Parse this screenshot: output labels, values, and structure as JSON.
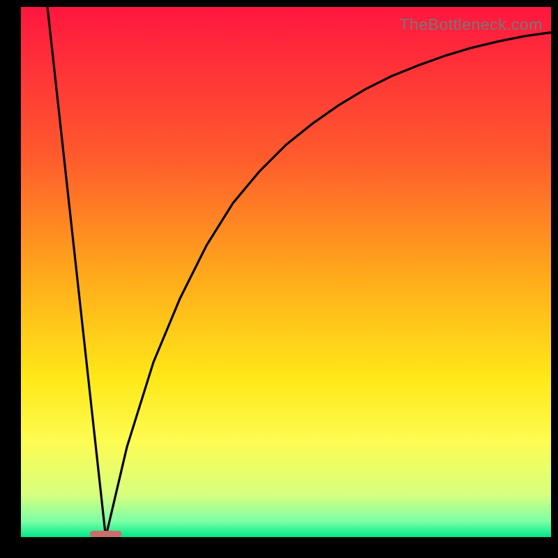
{
  "watermark": "TheBottleneck.com",
  "colors": {
    "gradient_stops": [
      {
        "pct": 0,
        "color": "#ff163f"
      },
      {
        "pct": 28,
        "color": "#ff5a2d"
      },
      {
        "pct": 52,
        "color": "#ffae1a"
      },
      {
        "pct": 70,
        "color": "#ffe818"
      },
      {
        "pct": 82,
        "color": "#fdfc52"
      },
      {
        "pct": 92,
        "color": "#d7ff7e"
      },
      {
        "pct": 97,
        "color": "#7cffa6"
      },
      {
        "pct": 100,
        "color": "#00e88a"
      }
    ],
    "curve": "#000000",
    "marker": "#c96d6d",
    "frame": "#000000"
  },
  "chart_data": {
    "type": "line",
    "title": "",
    "xlabel": "",
    "ylabel": "",
    "xlim": [
      0,
      100
    ],
    "ylim": [
      0,
      100
    ],
    "grid": false,
    "legend": false,
    "marker": {
      "x": 16,
      "width": 6,
      "y": 0.6,
      "height": 1.2
    },
    "series": [
      {
        "name": "left-falling-line",
        "x": [
          5,
          16
        ],
        "values": [
          100,
          0
        ]
      },
      {
        "name": "right-rising-curve",
        "x": [
          16,
          20,
          25,
          30,
          35,
          40,
          45,
          50,
          55,
          60,
          65,
          70,
          75,
          80,
          85,
          90,
          95,
          100
        ],
        "values": [
          0,
          17,
          33,
          45,
          55,
          63,
          69,
          74,
          78,
          81.5,
          84.5,
          87,
          89,
          90.8,
          92.3,
          93.5,
          94.5,
          95.2
        ]
      }
    ]
  }
}
